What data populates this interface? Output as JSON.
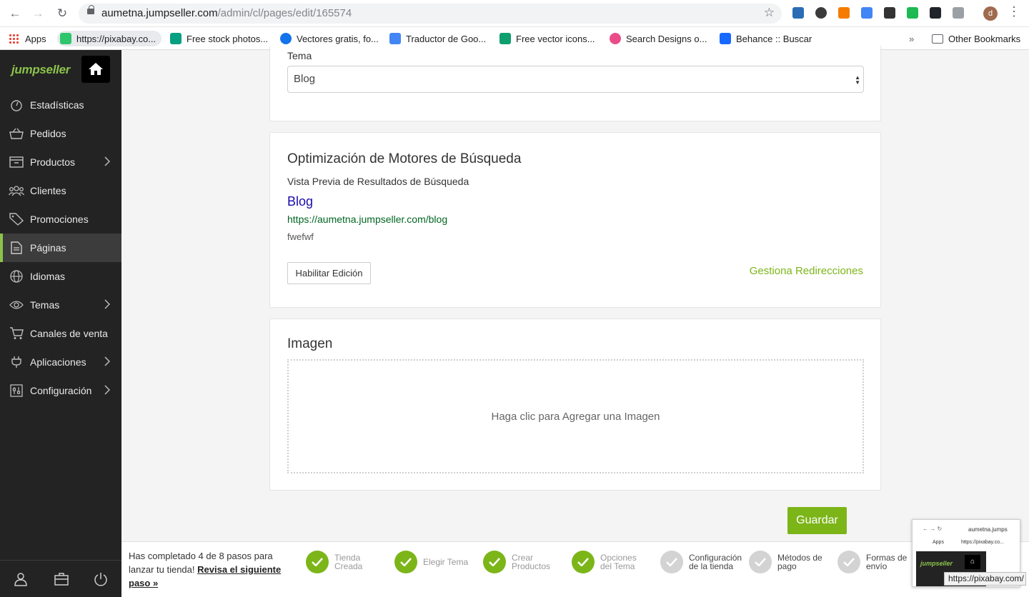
{
  "browser": {
    "url_host": "aumetna.jumpseller.com",
    "url_path": "/admin/cl/pages/edit/165574",
    "profile_initial": "d"
  },
  "bookmarks": [
    {
      "label": "Apps"
    },
    {
      "label": "https://pixabay.co..."
    },
    {
      "label": "Free stock photos..."
    },
    {
      "label": "Vectores gratis, fo..."
    },
    {
      "label": "Traductor de Goo..."
    },
    {
      "label": "Free vector icons..."
    },
    {
      "label": "Search Designs o..."
    },
    {
      "label": "Behance :: Buscar"
    },
    {
      "label": "Other Bookmarks"
    }
  ],
  "sidebar": {
    "logo": "jumpseller",
    "items": [
      {
        "label": "Estadísticas"
      },
      {
        "label": "Pedidos"
      },
      {
        "label": "Productos"
      },
      {
        "label": "Clientes"
      },
      {
        "label": "Promociones"
      },
      {
        "label": "Páginas"
      },
      {
        "label": "Idiomas"
      },
      {
        "label": "Temas"
      },
      {
        "label": "Canales de venta"
      },
      {
        "label": "Aplicaciones"
      },
      {
        "label": "Configuración"
      }
    ]
  },
  "theme_card": {
    "label": "Tema",
    "selected": "Blog"
  },
  "seo_card": {
    "title": "Optimización de Motores de Búsqueda",
    "preview_label": "Vista Previa de Resultados de Búsqueda",
    "preview_title": "Blog",
    "preview_url": "https://aumetna.jumpseller.com/blog",
    "preview_description": "fwefwf",
    "enable_edit_label": "Habilitar Edición",
    "redirects_link": "Gestiona Redirecciones"
  },
  "image_card": {
    "title": "Imagen",
    "dropzone_text": "Haga clic para Agregar una Imagen"
  },
  "save_label": "Guardar",
  "onboarding": {
    "text_before": "Has completado 4 de 8 pasos para lanzar tu tienda!",
    "link": "Revisa el siguiente paso »",
    "steps": [
      {
        "line1": "Tienda",
        "line2": "Creada",
        "done": true
      },
      {
        "line1": "Elegir Tema",
        "line2": "",
        "done": true
      },
      {
        "line1": "Crear",
        "line2": "Productos",
        "done": true
      },
      {
        "line1": "Opciones",
        "line2": "del Tema",
        "done": true
      },
      {
        "line1": "Configuración",
        "line2": "de la tienda",
        "done": false
      },
      {
        "line1": "Métodos de",
        "line2": "pago",
        "done": false
      },
      {
        "line1": "Formas de",
        "line2": "envío",
        "done": false
      }
    ]
  },
  "tab_preview": {
    "url": "aumetna.jumps",
    "bookmark": "Apps",
    "bookmark2": "https://pixabay.co...",
    "logo": "jumpseller",
    "tooltip": "https://pixabay.com/"
  },
  "colors": {
    "brand_green": "#7cb518",
    "sidebar_bg": "#232323"
  }
}
